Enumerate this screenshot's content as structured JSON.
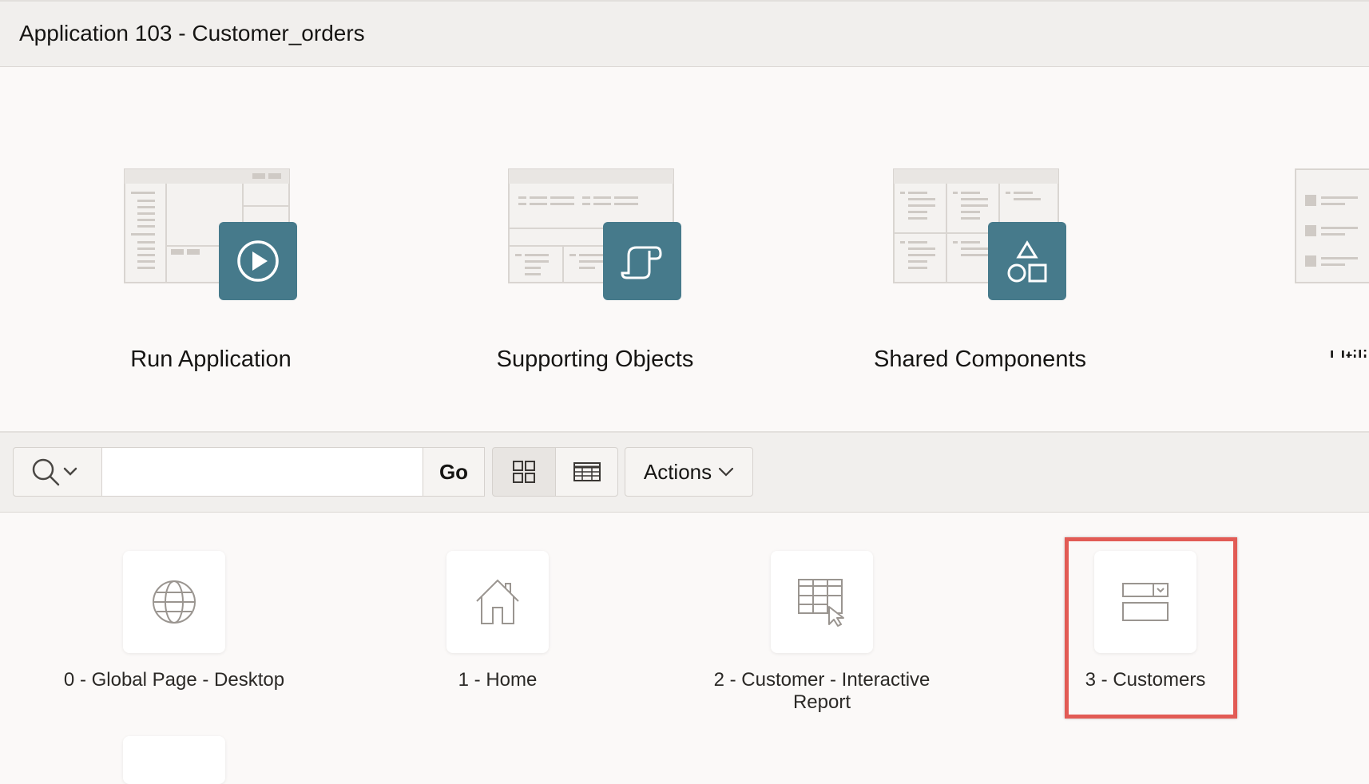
{
  "header": {
    "title": "Application 103 - Customer_orders"
  },
  "hero_cards": [
    {
      "label": "Run Application",
      "icon": "play-icon"
    },
    {
      "label": "Supporting Objects",
      "icon": "scroll-icon"
    },
    {
      "label": "Shared Components",
      "icon": "shapes-icon"
    },
    {
      "label": "Utili",
      "icon": "utilities-icon"
    }
  ],
  "toolbar": {
    "search_icon": "search-icon",
    "search_value": "",
    "go_label": "Go",
    "actions_label": "Actions"
  },
  "pages": [
    {
      "label": "0 - Global Page - Desktop",
      "icon": "globe-icon"
    },
    {
      "label": "1 - Home",
      "icon": "home-icon"
    },
    {
      "label": "2 - Customer - Interactive Report",
      "icon": "report-icon"
    },
    {
      "label": "3 - Customers",
      "icon": "form-icon"
    }
  ],
  "colors": {
    "accent": "#467a8b",
    "highlight": "#e25b55"
  }
}
